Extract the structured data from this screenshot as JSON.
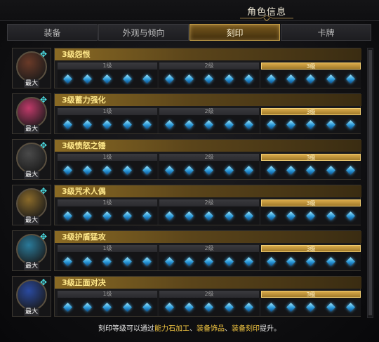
{
  "window": {
    "title": "角色信息"
  },
  "tabs": [
    {
      "label": "装备",
      "active": false
    },
    {
      "label": "外观与倾向",
      "active": false
    },
    {
      "label": "刻印",
      "active": true
    },
    {
      "label": "卡牌",
      "active": false
    }
  ],
  "engravings": [
    {
      "name": "3级怨恨",
      "badge": "最大",
      "levels": [
        "1级",
        "2级",
        "3级"
      ],
      "active_level": 3,
      "icon_color": "#6a3a28"
    },
    {
      "name": "3级蓄力强化",
      "badge": "最大",
      "levels": [
        "1级",
        "2级",
        "3级"
      ],
      "active_level": 3,
      "icon_color": "#c03a6a"
    },
    {
      "name": "3级愤怒之锤",
      "badge": "最大",
      "levels": [
        "1级",
        "2级",
        "3级"
      ],
      "active_level": 3,
      "icon_color": "#4a4a4a"
    },
    {
      "name": "3级咒术人偶",
      "badge": "最大",
      "levels": [
        "1级",
        "2级",
        "3级"
      ],
      "active_level": 3,
      "icon_color": "#8a6a2a"
    },
    {
      "name": "3级护盾猛攻",
      "badge": "最大",
      "levels": [
        "1级",
        "2级",
        "3级"
      ],
      "active_level": 3,
      "icon_color": "#2a7a9a"
    },
    {
      "name": "3级正面对决",
      "badge": "最大",
      "levels": [
        "1级",
        "2级",
        "3级"
      ],
      "active_level": 3,
      "icon_color": "#2a4aa0"
    }
  ],
  "footer": {
    "prefix": "刻印等级可以通过",
    "hl1": "能力石加工",
    "sep1": "、",
    "hl2": "装备饰品",
    "sep2": "、",
    "hl3": "装备刻印",
    "suffix": "提升。"
  }
}
